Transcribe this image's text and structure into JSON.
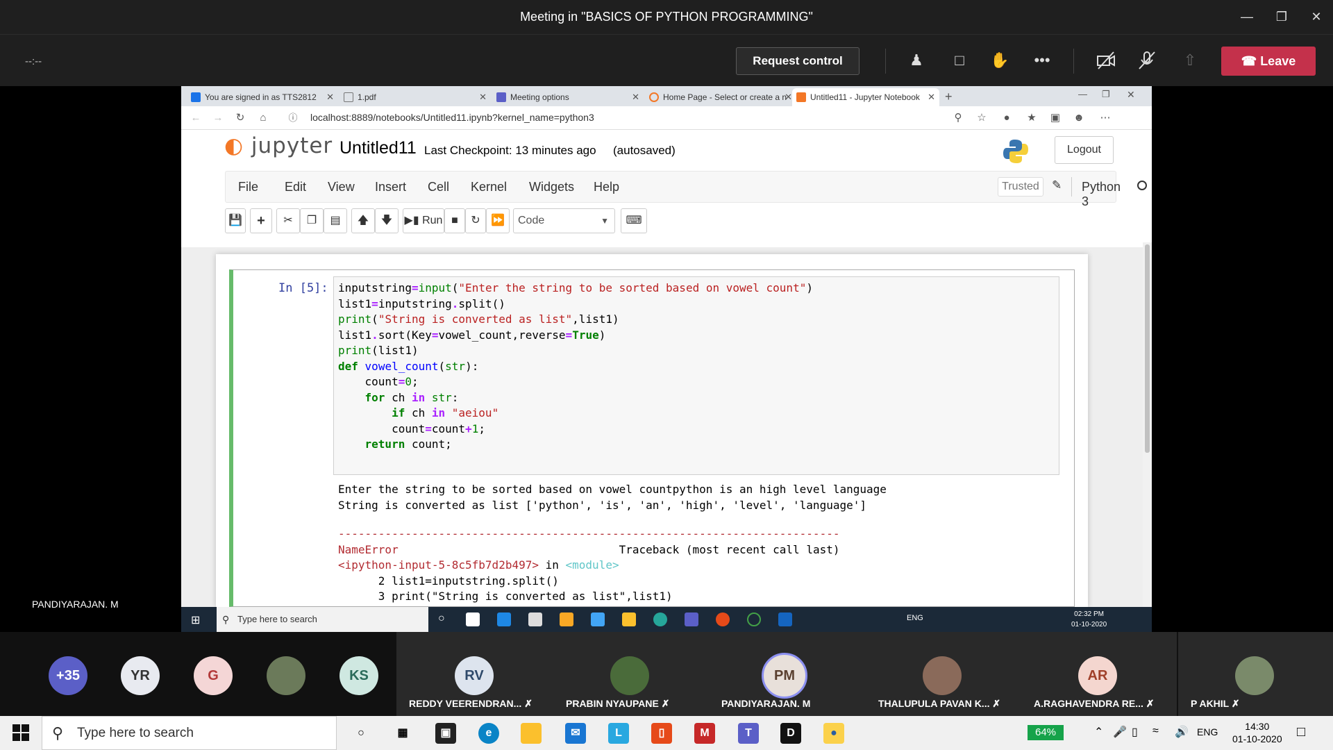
{
  "meeting": {
    "title": "Meeting in \"BASICS OF PYTHON PROGRAMMING\"",
    "timer": "--:--",
    "request_control": "Request control",
    "leave": "Leave"
  },
  "browser": {
    "tabs": [
      {
        "label": "You are signed in as TTS2812",
        "icon_color": "#1a73e8"
      },
      {
        "label": "1.pdf",
        "icon_color": "#ffffff"
      },
      {
        "label": "Meeting options",
        "icon_color": "#5b5fc7"
      },
      {
        "label": "Home Page - Select or create a n",
        "icon_color": "#f37726"
      },
      {
        "label": "Untitled11 - Jupyter Notebook",
        "icon_color": "#f37726"
      }
    ],
    "url": "localhost:8889/notebooks/Untitled11.ipynb?kernel_name=python3"
  },
  "jupyter": {
    "logo": "jupyter",
    "notebook_name": "Untitled11",
    "checkpoint": "Last Checkpoint: 13 minutes ago",
    "autosaved": "(autosaved)",
    "logout": "Logout",
    "menu": [
      "File",
      "Edit",
      "View",
      "Insert",
      "Cell",
      "Kernel",
      "Widgets",
      "Help"
    ],
    "trusted": "Trusted",
    "kernel": "Python 3",
    "run_label": "Run",
    "cell_type": "Code",
    "prompt": "In [5]:"
  },
  "inner_taskbar": {
    "search": "Type here to search",
    "lang": "ENG",
    "time": "02:32 PM",
    "date": "01-10-2020"
  },
  "presenter_name": "PANDIYARAJAN. M",
  "participants": [
    {
      "initials": "+35",
      "name": "",
      "color": "#5b5fc7",
      "text_color": "#ffffff"
    },
    {
      "initials": "YR",
      "name": "",
      "color": "#e8eaf0",
      "text_color": "#333333"
    },
    {
      "initials": "G",
      "name": "",
      "color": "#f4d6d6",
      "text_color": "#b33a3a"
    },
    {
      "initials": "",
      "name": "",
      "color": "#6b7a5a",
      "text_color": "#ffffff"
    },
    {
      "initials": "KS",
      "name": "",
      "color": "#cfe8e1",
      "text_color": "#2a6b5a"
    },
    {
      "initials": "RV",
      "name": "REDDY VEERENDRAN...",
      "color": "#dde4ee",
      "text_color": "#2f4a6b"
    },
    {
      "initials": "",
      "name": "PRABIN NYAUPANE",
      "color": "#4a6b3a",
      "text_color": "#ffffff"
    },
    {
      "initials": "PM",
      "name": "PANDIYARAJAN. M",
      "color": "#e8e0da",
      "text_color": "#5a4030"
    },
    {
      "initials": "",
      "name": "THALUPULA PAVAN K...",
      "color": "#8a6a5a",
      "text_color": "#ffffff"
    },
    {
      "initials": "AR",
      "name": "A.RAGHAVENDRA RE...",
      "color": "#f4d6cf",
      "text_color": "#a0402a"
    },
    {
      "initials": "",
      "name": "P AKHIL",
      "color": "#7a8a6a",
      "text_color": "#ffffff"
    }
  ],
  "taskbar": {
    "search": "Type here to search",
    "battery": "64%",
    "lang": "ENG",
    "time": "14:30",
    "date": "01-10-2020"
  },
  "output": {
    "line1": "Enter the string to be sorted based on vowel countpython is an high level language",
    "line2": "String is converted as list ['python', 'is', 'an', 'high', 'level', 'language']",
    "dashes": "---------------------------------------------------------------------------",
    "error": "NameError",
    "traceback": "Traceback (most recent call last)",
    "input_ref": "<ipython-input-5-8c5fb7d2b497>",
    "in_word": " in ",
    "module": "<module>",
    "tb_line2": "      2 list1=inputstring.split()",
    "tb_line3_num": "      3 ",
    "tb_line3_code": "print(\"String is converted as list\",list1)"
  }
}
